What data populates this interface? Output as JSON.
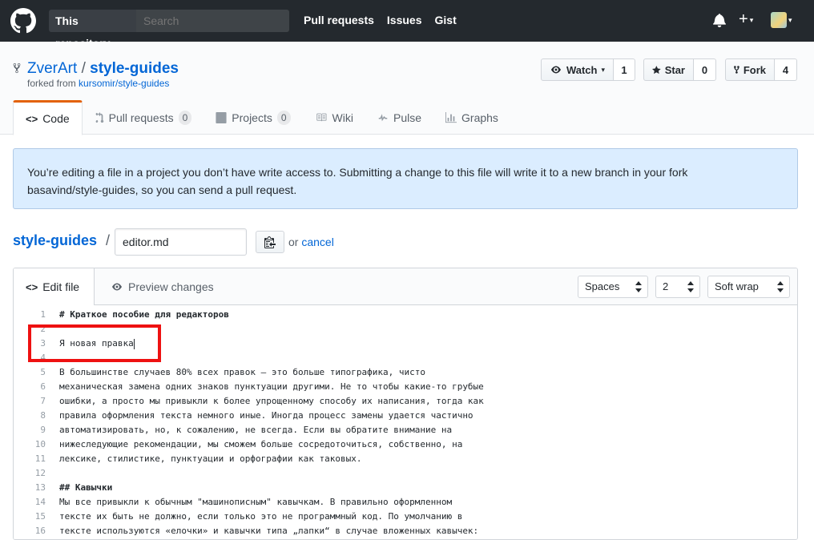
{
  "header": {
    "scope_label": "This repository",
    "search_placeholder": "Search",
    "nav": [
      "Pull requests",
      "Issues",
      "Gist"
    ]
  },
  "repo": {
    "owner": "ZverArt",
    "separator": "/",
    "name": "style-guides",
    "forked_from_prefix": "forked from",
    "forked_from": "kursomir/style-guides",
    "watch_label": "Watch",
    "watch_count": "1",
    "star_label": "Star",
    "star_count": "0",
    "fork_label": "Fork",
    "fork_count": "4",
    "tabs": [
      {
        "label": "Code"
      },
      {
        "label": "Pull requests",
        "count": "0"
      },
      {
        "label": "Projects",
        "count": "0"
      },
      {
        "label": "Wiki"
      },
      {
        "label": "Pulse"
      },
      {
        "label": "Graphs"
      }
    ]
  },
  "flash": {
    "line1": "You’re editing a file in a project you don’t have write access to. Submitting a change to this file will write it to a new branch in your fork",
    "line2": "basavind/style-guides, so you can send a pull request."
  },
  "breadcrumb": {
    "root": "style-guides",
    "separator": "/",
    "filename": "editor.md",
    "or_text": "or",
    "cancel": "cancel"
  },
  "editor": {
    "tab_edit": "Edit file",
    "tab_preview": "Preview changes",
    "indent_mode": "Spaces",
    "indent_size": "2",
    "wrap_mode": "Soft wrap",
    "lines": [
      {
        "n": "1",
        "text": "# Краткое пособие для редакторов",
        "bold": true
      },
      {
        "n": "2",
        "text": ""
      },
      {
        "n": "3",
        "text": "Я новая правка"
      },
      {
        "n": "4",
        "text": ""
      },
      {
        "n": "5",
        "text": "В большинстве случаев 80% всех правок — это больше типографика, чисто"
      },
      {
        "n": "6",
        "text": "механическая замена одних знаков пунктуации другими. Не то чтобы какие-то грубые"
      },
      {
        "n": "7",
        "text": "ошибки, а просто мы привыкли к более упрощенному способу их написания, тогда как"
      },
      {
        "n": "8",
        "text": "правила оформления текста немного иные. Иногда процесс замены удается частично"
      },
      {
        "n": "9",
        "text": "автоматизировать, но, к сожалению, не всегда. Если вы обратите внимание на"
      },
      {
        "n": "10",
        "text": "нижеследующие рекомендации, мы сможем больше сосредоточиться, собственно, на"
      },
      {
        "n": "11",
        "text": "лексике, стилистике, пунктуации и орфографии как таковых."
      },
      {
        "n": "12",
        "text": ""
      },
      {
        "n": "13",
        "text": "## Кавычки",
        "bold": true
      },
      {
        "n": "14",
        "text": "Мы все привыкли к обычным \"машинописным\" кавычкам. В правильно оформленном"
      },
      {
        "n": "15",
        "text": "тексте их быть не должно, если только это не программный код. По умолчанию в"
      },
      {
        "n": "16",
        "text": "тексте используются «елочки» и кавычки типа „лапки“ в случае вложенных кавычек:"
      }
    ]
  }
}
